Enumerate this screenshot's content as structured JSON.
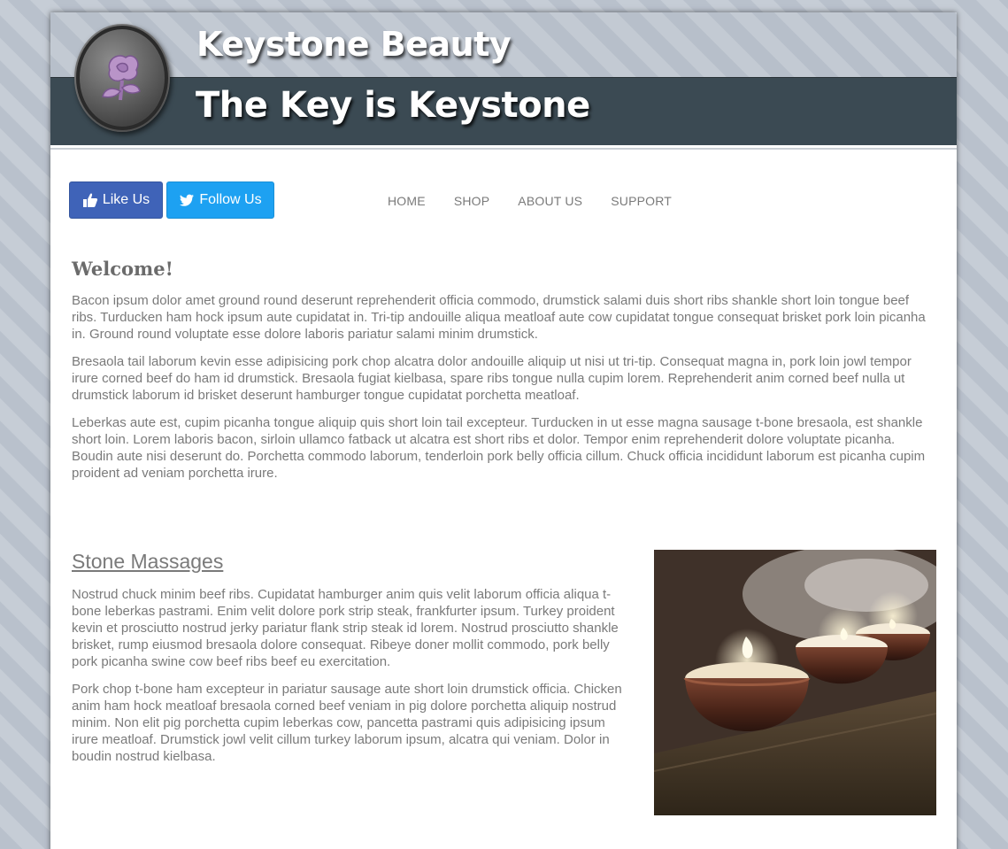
{
  "header": {
    "brand": "Keystone Beauty",
    "tagline": "The Key is Keystone"
  },
  "social": {
    "like_label": "Like Us",
    "follow_label": "Follow Us"
  },
  "nav": {
    "items": [
      {
        "label": "HOME"
      },
      {
        "label": "SHOP"
      },
      {
        "label": "ABOUT US"
      },
      {
        "label": "SUPPORT"
      }
    ]
  },
  "welcome": {
    "title": "Welcome!",
    "paragraphs": [
      "Bacon ipsum dolor amet ground round deserunt reprehenderit officia commodo, drumstick salami duis short ribs shankle short loin tongue beef ribs. Turducken ham hock ipsum aute cupidatat in. Tri-tip andouille aliqua meatloaf aute cow cupidatat tongue consequat brisket pork loin picanha in. Ground round voluptate esse dolore laboris pariatur salami minim drumstick.",
      "Bresaola tail laborum kevin esse adipisicing pork chop alcatra dolor andouille aliquip ut nisi ut tri-tip. Consequat magna in, pork loin jowl tempor irure corned beef do ham id drumstick. Bresaola fugiat kielbasa, spare ribs tongue nulla cupim lorem. Reprehenderit anim corned beef nulla ut drumstick laborum id brisket deserunt hamburger tongue cupidatat porchetta meatloaf.",
      "Leberkas aute est, cupim picanha tongue aliquip quis short loin tail excepteur. Turducken in ut esse magna sausage t-bone bresaola, est shankle short loin. Lorem laboris bacon, sirloin ullamco fatback ut alcatra est short ribs et dolor. Tempor enim reprehenderit dolore voluptate picanha. Boudin aute nisi deserunt do. Porchetta commodo laborum, tenderloin pork belly officia cillum. Chuck officia incididunt laborum est picanha cupim proident ad veniam porchetta irure."
    ]
  },
  "massages": {
    "title": "Stone Massages",
    "paragraphs": [
      "Nostrud chuck minim beef ribs. Cupidatat hamburger anim quis velit laborum officia aliqua t-bone leberkas pastrami. Enim velit dolore pork strip steak, frankfurter ipsum. Turkey proident kevin et prosciutto nostrud jerky pariatur flank strip steak id lorem. Nostrud prosciutto shankle brisket, rump eiusmod bresaola dolore consequat. Ribeye doner mollit commodo, pork belly pork picanha swine cow beef ribs beef eu exercitation.",
      "Pork chop t-bone ham excepteur in pariatur sausage aute short loin drumstick officia. Chicken anim ham hock meatloaf bresaola corned beef veniam in pig dolore porchetta aliquip nostrud minim. Non elit pig porchetta cupim leberkas cow, pancetta pastrami quis adipisicing ipsum irure meatloaf. Drumstick jowl velit cillum turkey laborum ipsum, alcatra qui veniam. Dolor in boudin nostrud kielbasa."
    ]
  },
  "colors": {
    "like": "#3f63b8",
    "follow": "#1da1f2",
    "banner_dark": "#3b4a53",
    "text": "#7a7a7a"
  },
  "icons": {
    "like": "thumbs-up-icon",
    "follow": "twitter-bird-icon",
    "logo": "rose-stone-logo"
  }
}
